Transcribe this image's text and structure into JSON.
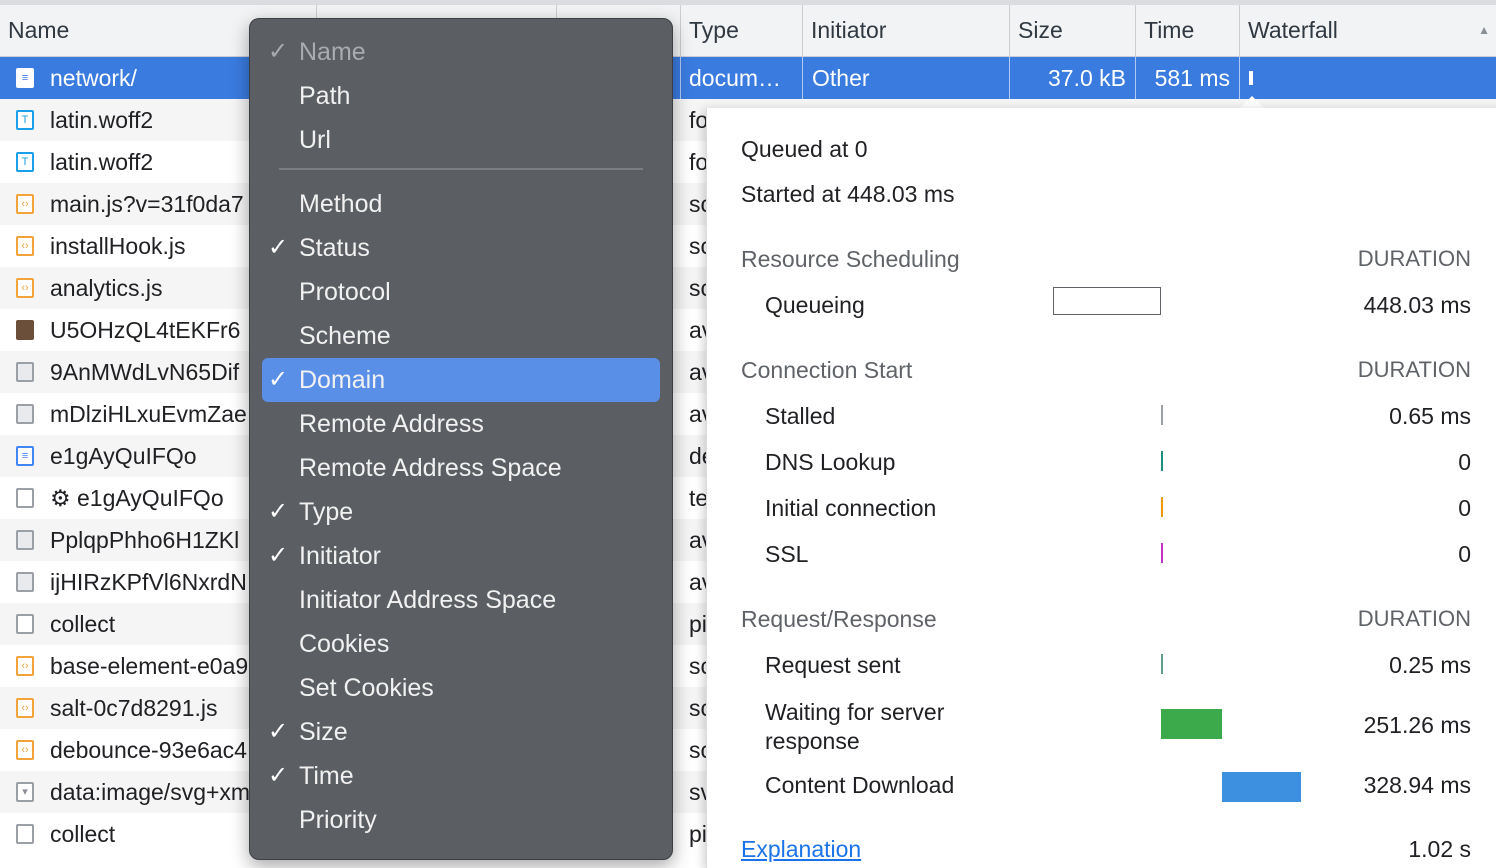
{
  "header": {
    "name": "Name",
    "type": "Type",
    "initiator": "Initiator",
    "size": "Size",
    "time": "Time",
    "waterfall": "Waterfall",
    "sort_glyph": "▲"
  },
  "selected_row": {
    "name": "network/",
    "type": "docum…",
    "initiator": "Other",
    "size": "37.0 kB",
    "time": "581 ms"
  },
  "rows": [
    {
      "icon": "font-file-icon",
      "glyph": "T",
      "name": "latin.woff2",
      "type": "fo"
    },
    {
      "icon": "font-file-icon",
      "glyph": "T",
      "name": "latin.woff2",
      "type": "fo"
    },
    {
      "icon": "script-file-icon",
      "glyph": "‹›",
      "name": "main.js?v=31f0da7",
      "type": "sc"
    },
    {
      "icon": "script-file-icon",
      "glyph": "‹›",
      "name": "installHook.js",
      "type": "sc"
    },
    {
      "icon": "script-file-icon",
      "glyph": "‹›",
      "name": "analytics.js",
      "type": "sc"
    },
    {
      "icon": "photo-thumbnail-icon",
      "glyph": "",
      "name": "U5OHzQL4tEKFr6",
      "type": "av"
    },
    {
      "icon": "image-file-icon",
      "glyph": "",
      "name": "9AnMWdLvN65Dif",
      "type": "av"
    },
    {
      "icon": "image-file-icon",
      "glyph": "",
      "name": "mDlziHLxuEvmZae",
      "type": "av"
    },
    {
      "icon": "document-file-icon",
      "glyph": "≡",
      "name": "e1gAyQuIFQo",
      "type": "de"
    },
    {
      "icon": "blank-file-icon",
      "glyph": "",
      "name": "⚙ e1gAyQuIFQo",
      "type": "te"
    },
    {
      "icon": "image-file-icon",
      "glyph": "",
      "name": "PplqpPhho6H1ZKl",
      "type": "av"
    },
    {
      "icon": "image-file-icon",
      "glyph": "",
      "name": "ijHIRzKPfVl6NxrdN",
      "type": "av"
    },
    {
      "icon": "blank-file-icon",
      "glyph": "",
      "name": "collect",
      "type": "pi"
    },
    {
      "icon": "script-file-icon",
      "glyph": "‹›",
      "name": "base-element-e0a9",
      "type": "sc"
    },
    {
      "icon": "script-file-icon",
      "glyph": "‹›",
      "name": "salt-0c7d8291.js",
      "type": "sc"
    },
    {
      "icon": "script-file-icon",
      "glyph": "‹›",
      "name": "debounce-93e6ac4",
      "type": "sc"
    },
    {
      "icon": "svg-file-icon",
      "glyph": "▾",
      "name": "data:image/svg+xml",
      "type": "sv"
    },
    {
      "icon": "blank-file-icon",
      "glyph": "",
      "name": "collect",
      "type": "pi"
    }
  ],
  "menu": {
    "group1": [
      {
        "label": "Name",
        "checked": true,
        "disabled": true
      },
      {
        "label": "Path",
        "checked": false
      },
      {
        "label": "Url",
        "checked": false
      }
    ],
    "group2": [
      {
        "label": "Method",
        "checked": false
      },
      {
        "label": "Status",
        "checked": true
      },
      {
        "label": "Protocol",
        "checked": false
      },
      {
        "label": "Scheme",
        "checked": false
      },
      {
        "label": "Domain",
        "checked": true,
        "highlighted": true
      },
      {
        "label": "Remote Address",
        "checked": false
      },
      {
        "label": "Remote Address Space",
        "checked": false
      },
      {
        "label": "Type",
        "checked": true
      },
      {
        "label": "Initiator",
        "checked": true
      },
      {
        "label": "Initiator Address Space",
        "checked": false
      },
      {
        "label": "Cookies",
        "checked": false
      },
      {
        "label": "Set Cookies",
        "checked": false
      },
      {
        "label": "Size",
        "checked": true
      },
      {
        "label": "Time",
        "checked": true
      },
      {
        "label": "Priority",
        "checked": false
      }
    ],
    "check_glyph": "✓"
  },
  "timing": {
    "queued_at": "Queued at 0",
    "started_at": "Started at 448.03 ms",
    "duration_label": "DURATION",
    "sections": [
      {
        "title": "Resource Scheduling",
        "items": [
          {
            "label": "Queueing",
            "value": "448.03 ms",
            "color": "#ffffff"
          }
        ]
      },
      {
        "title": "Connection Start",
        "items": [
          {
            "label": "Stalled",
            "value": "0.65 ms",
            "color": "#9aa0a6"
          },
          {
            "label": "DNS Lookup",
            "value": "0",
            "color": "#1e8e7e"
          },
          {
            "label": "Initial connection",
            "value": "0",
            "color": "#f29900"
          },
          {
            "label": "SSL",
            "value": "0",
            "color": "#c232c8"
          }
        ]
      },
      {
        "title": "Request/Response",
        "items": [
          {
            "label": "Request sent",
            "value": "0.25 ms",
            "color": "#5f9e8e"
          },
          {
            "label": "Waiting for server response",
            "value": "251.26 ms",
            "color": "#3ca94b"
          },
          {
            "label": "Content Download",
            "value": "328.94 ms",
            "color": "#3d8fdf"
          }
        ]
      }
    ],
    "explanation_link": "Explanation",
    "total_partial": "1.02 s"
  },
  "colors": {
    "selection": "#3a7be0",
    "menu_bg": "#5b5e63",
    "menu_highlight": "#5a8fe8"
  }
}
